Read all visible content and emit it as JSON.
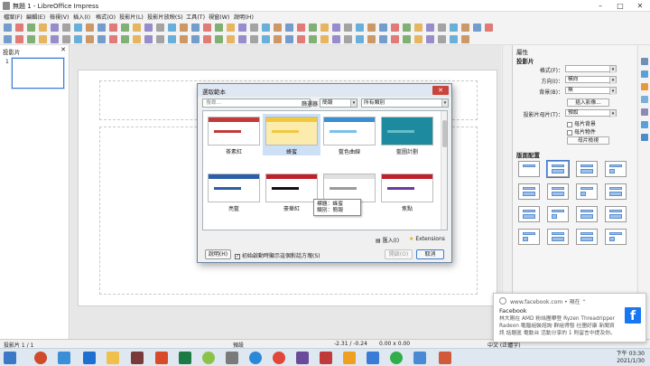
{
  "window": {
    "title": "無題 1 - LibreOffice Impress"
  },
  "menu": [
    "檔案(F)",
    "編輯(E)",
    "檢視(V)",
    "插入(I)",
    "格式(O)",
    "投影片(L)",
    "投影片放映(S)",
    "工具(T)",
    "視窗(W)",
    "說明(H)"
  ],
  "slide_pane": {
    "header": "投影片",
    "slide_number": "1"
  },
  "sidebar": {
    "section_slide": "投影片",
    "format_label": "格式(F)：",
    "orientation_label": "方向(I)：",
    "orientation_value": "橫向",
    "background_label": "背景(B)：",
    "background_value": "無",
    "insert_image": "插入影像...",
    "master_label": "投影片母片(T)：",
    "master_value": "預設",
    "master_background": "母片背景",
    "master_objects": "母片物件",
    "master_view": "母片檢視",
    "section_layout": "版面配置"
  },
  "dialog": {
    "title": "選取範本",
    "search_placeholder": "搜尋...",
    "filter_label": "篩選器",
    "filter_value": "簡報",
    "category_value": "所有類別",
    "templates": [
      "茶素紅",
      "蜂蜜",
      "藍色曲線",
      "藍圖計劃",
      "亮藍",
      "豪華紅",
      "DNA",
      "焦點"
    ],
    "tooltip_title": "標題：蜂蜜",
    "tooltip_category": "類別：簡報",
    "import": "匯入(I)",
    "extensions": "Extensions",
    "help": "說明(H)",
    "startup_checkbox": "初始啟動時顯示這個對話方塊(S)",
    "open": "開啟(O)",
    "cancel": "取消"
  },
  "statusbar": {
    "slide_count": "投影片 1 / 1",
    "master": "預設",
    "position": "-2.31 / -0.24",
    "size": "0.00 x 0.00",
    "language": "中文 (正體字)"
  },
  "taskbar": {
    "time": "下午 03:30",
    "date": "2021/1/30"
  },
  "notification": {
    "source": "www.facebook.com",
    "when": "現在",
    "title": "Facebook",
    "body": "林大剛在 AMD 粉絲團攀登 Ryzen Threadripper Radeon 電腦組裝諮詢 群組得發 社團好康 新聞資訊 話題區 電動台 活動分享的 1 則留言中提及你。"
  },
  "colors": {
    "accent": "#3d7dd6",
    "dialog_close": "#c9443a",
    "facebook": "#1877f2"
  }
}
